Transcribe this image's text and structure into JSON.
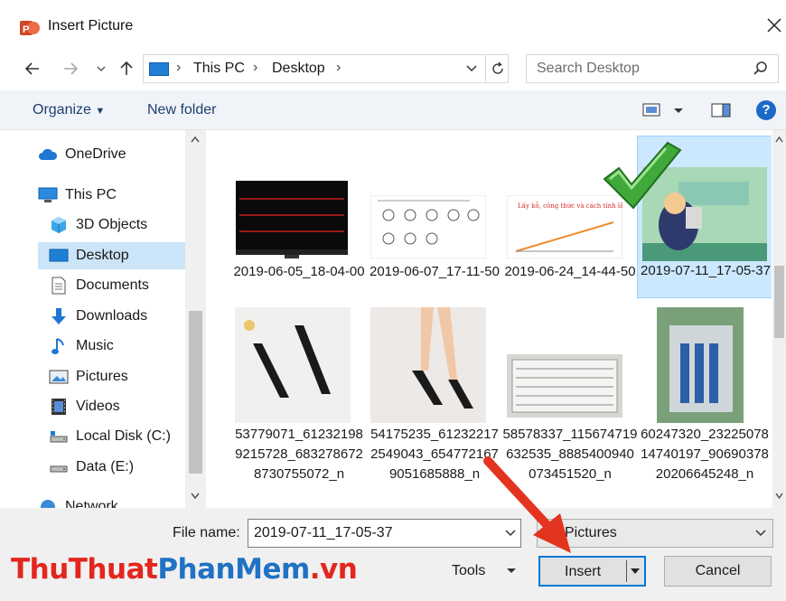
{
  "window": {
    "title": "Insert Picture"
  },
  "address": {
    "crumbs": [
      "This PC",
      "Desktop"
    ]
  },
  "search": {
    "placeholder": "Search Desktop"
  },
  "toolbar": {
    "organize": "Organize",
    "new_folder": "New folder"
  },
  "nav": {
    "items": [
      {
        "label": "OneDrive",
        "icon": "cloud-icon"
      },
      {
        "label": "This PC",
        "icon": "computer-icon"
      },
      {
        "label": "3D Objects",
        "icon": "cube-icon"
      },
      {
        "label": "Desktop",
        "icon": "desktop-icon"
      },
      {
        "label": "Documents",
        "icon": "document-icon"
      },
      {
        "label": "Downloads",
        "icon": "download-icon"
      },
      {
        "label": "Music",
        "icon": "music-icon"
      },
      {
        "label": "Pictures",
        "icon": "picture-icon"
      },
      {
        "label": "Videos",
        "icon": "video-icon"
      },
      {
        "label": "Local Disk (C:)",
        "icon": "drive-icon"
      },
      {
        "label": "Data (E:)",
        "icon": "drive-icon"
      },
      {
        "label": "Network",
        "icon": "network-icon"
      }
    ]
  },
  "files": [
    {
      "name": "2019-06-05_18-04-00"
    },
    {
      "name": "2019-06-07_17-11-50"
    },
    {
      "name": "2019-06-24_14-44-50"
    },
    {
      "name": "2019-07-11_17-05-37"
    },
    {
      "name": "53779071_612321989215728_6832786728730755072_n"
    },
    {
      "name": "54175235_612322172549043_6547721679051685888_n"
    },
    {
      "name": "58578337_115674719632535_8885400940073451520_n"
    },
    {
      "name": "60247320_2322507814740197_9069037820206645248_n"
    }
  ],
  "thumb_text": {
    "chart_title": "Lấy kỗ, công thức và cách tính lãi kép"
  },
  "footer": {
    "file_name_label": "File name:",
    "file_name_value": "2019-07-11_17-05-37",
    "file_type": "Pictures",
    "tools": "Tools",
    "insert": "Insert",
    "cancel": "Cancel"
  },
  "watermark": {
    "part1": "ThuThuat",
    "part2": "PhanMem",
    "part3": ".vn"
  },
  "colors": {
    "accent": "#0078d7",
    "selection": "#cce8ff",
    "watermark_red": "#e3261e",
    "watermark_blue": "#1f72c4"
  }
}
